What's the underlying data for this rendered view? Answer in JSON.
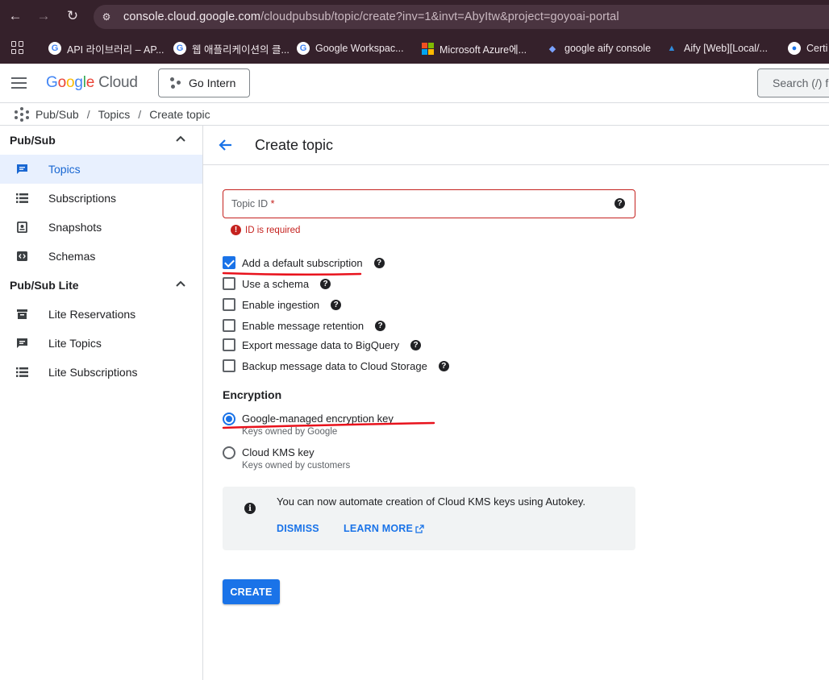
{
  "browser": {
    "url_host": "console.cloud.google.com",
    "url_path": "/cloudpubsub/topic/create?inv=1&invt=AbyItw&project=goyoai-portal",
    "bookmarks": [
      {
        "label": "API 라이브러리 – AP...",
        "icon": "google-favicon"
      },
      {
        "label": "웹 애플리케이션의 클...",
        "icon": "google-favicon"
      },
      {
        "label": "Google Workspac...",
        "icon": "google-favicon"
      },
      {
        "label": "Microsoft Azure에...",
        "icon": "microsoft-favicon"
      },
      {
        "label": "google aify console",
        "icon": "shield-favicon"
      },
      {
        "label": "Aify [Web][Local/...",
        "icon": "azure-favicon"
      },
      {
        "label": "Certi",
        "icon": "apple-favicon"
      }
    ]
  },
  "header": {
    "logo_google": "Google",
    "logo_cloud": "Cloud",
    "project": "Go Intern",
    "search_placeholder": "Search (/) f"
  },
  "breadcrumb": [
    "Pub/Sub",
    "Topics",
    "Create topic"
  ],
  "sidebar": {
    "section1": "Pub/Sub",
    "items1": [
      {
        "label": "Topics",
        "active": true
      },
      {
        "label": "Subscriptions"
      },
      {
        "label": "Snapshots"
      },
      {
        "label": "Schemas"
      }
    ],
    "section2": "Pub/Sub Lite",
    "items2": [
      {
        "label": "Lite Reservations"
      },
      {
        "label": "Lite Topics"
      },
      {
        "label": "Lite Subscriptions"
      }
    ]
  },
  "main": {
    "title": "Create topic",
    "topic_label": "Topic ID",
    "topic_required": "*",
    "topic_error": "ID is required",
    "options": [
      {
        "label": "Add a default subscription",
        "checked": true
      },
      {
        "label": "Use a schema",
        "checked": false
      },
      {
        "label": "Enable ingestion",
        "checked": false
      },
      {
        "label": "Enable message retention",
        "checked": false
      },
      {
        "label": "Export message data to BigQuery",
        "checked": false
      },
      {
        "label": "Backup message data to Cloud Storage",
        "checked": false
      }
    ],
    "encryption_title": "Encryption",
    "encryption_options": [
      {
        "label": "Google-managed encryption key",
        "sub": "Keys owned by Google",
        "selected": true
      },
      {
        "label": "Cloud KMS key",
        "sub": "Keys owned by customers",
        "selected": false
      }
    ],
    "notice_text": "You can now automate creation of Cloud KMS keys using Autokey.",
    "notice_dismiss": "DISMISS",
    "notice_learn": "LEARN MORE",
    "create_label": "CREATE"
  },
  "colors": {
    "accent": "#1a73e8",
    "error": "#c5221f",
    "annotation": "#e8121c"
  }
}
